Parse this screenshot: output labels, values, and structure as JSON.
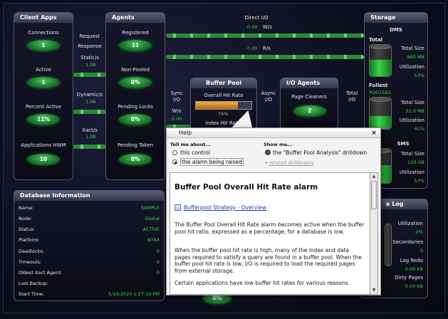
{
  "client_apps": {
    "title": "Client Apps",
    "items": [
      {
        "label": "Connections",
        "value": "1"
      },
      {
        "label": "Active",
        "value": "1"
      },
      {
        "label": "Percent Active",
        "value": "11%"
      },
      {
        "label": "Applications HWM",
        "value": "10"
      }
    ]
  },
  "request_response": {
    "request_label": "Request",
    "response_label": "Response",
    "static_label": "Static/s",
    "static_value": "1.08",
    "dynamic_label": "Dynamic/s",
    "dynamic_value": "1.08",
    "xact_label": "Xact/s",
    "xact_value": "1.08"
  },
  "agents": {
    "title": "Agents",
    "items": [
      {
        "label": "Registered",
        "value": "11"
      },
      {
        "label": "Non-Pooled",
        "value": "0%"
      },
      {
        "label": "Pending Locks",
        "value": "0%"
      },
      {
        "label": "Pending Token",
        "value": "0%"
      }
    ]
  },
  "direct_io": {
    "title": "Direct I/O",
    "write_value": "0.00",
    "write_unit": "W/s",
    "read_value": "0.00",
    "read_unit": "R/s"
  },
  "buffer_pool": {
    "title": "Buffer Pool",
    "hit_rate_label": "Overall Hit Rate",
    "hit_rate_value": "75%",
    "hit_rate_fraction": 0.75,
    "index_label": "Index Hit Ratio"
  },
  "sync_io": {
    "label1": "Sync",
    "label2": "I/O",
    "unit": "W/s",
    "value": "0.00"
  },
  "async_io": {
    "label1": "Async",
    "label2": "I/O"
  },
  "io_agents": {
    "title": "I/O Agents",
    "page_cleaners_label": "Page Cleaners",
    "page_cleaners_value": "2"
  },
  "total_io": {
    "label1": "Total",
    "label2": "I/O"
  },
  "storage": {
    "title": "Storage",
    "dms_label": "DMS",
    "total_label": "Total",
    "total_size_label": "Total Size",
    "total_size_value": "900 MB",
    "utilization_label": "Utilization",
    "total_util_value": "53%",
    "total_util_fraction": 0.53,
    "fullest_label": "Fullest",
    "fullest_name": "POD1SA1",
    "fullest_size_label": "Total Size",
    "fullest_size_value": "32.0 MB",
    "fullest_util_label": "Utilization",
    "fullest_util_value": "41%",
    "fullest_util_fraction": 0.41,
    "sms_label": "SMS",
    "sms_size_label": "Total Size",
    "sms_size_value": "120 GB",
    "sms_util_label": "Utilization",
    "sms_util_value": "53%",
    "sms_util_fraction": 0.53
  },
  "log": {
    "title_suffix": "e Log",
    "utilization_label": "Utilization",
    "utilization_value": "0%",
    "secondaries_label": "Secondaries",
    "secondaries_value": "0",
    "log_redo_label": "Log Redo",
    "log_redo_value": "0.00 KB",
    "dirty_pages_label": "Dirty Pages",
    "dirty_pages_value": "0.00 KB"
  },
  "partial_bottom_value": "0%",
  "database_info": {
    "title": "Database Information",
    "rows": [
      {
        "key": "Name:",
        "value": "SAMPLE"
      },
      {
        "key": "Node:",
        "value": "Global"
      },
      {
        "key": "Status:",
        "value": "ACTIVE"
      },
      {
        "key": "Platform:",
        "value": "NT64"
      },
      {
        "key": "Deadlocks:",
        "value": "0"
      },
      {
        "key": "Timeouts:",
        "value": "0"
      },
      {
        "key": "Oldest Xact Agent:",
        "value": "0"
      },
      {
        "key": "Last Backup:",
        "value": ""
      },
      {
        "key": "Start Time:",
        "value": "5/10/2020 1:27:19 PM"
      }
    ]
  },
  "help": {
    "title": "Help",
    "close_glyph": "×",
    "tell_me_label": "Tell me about...",
    "option_control": "this control",
    "option_alarm": "the alarm being raised",
    "show_me_label": "Show me...",
    "show_me_item": "the \"Buffer Pool Analysis\" drilldown",
    "related_label": "related drilldowns",
    "content_title": "Buffer Pool Overall Hit Rate alarm",
    "link_text": "Bufferpool Strategy - Overview",
    "para1": "The Buffer Pool Overall Hit Rate alarm becomes active when the buffer pool hit ratio, expressed as a percentage, for a database is low.",
    "para2": "When the buffer pool hit rate is high, many of the index and data pages required to satisfy a query are found in a buffer pool. When the buffer pool hit rate is low, I/O is required to load the required pages from external storage.",
    "para3": "Certain applications have low buffer hit rates for various reasons."
  },
  "colors": {
    "accent_green": "#3fd24a",
    "bar_orange": "#e08a2a",
    "link_blue": "#1a3fb0"
  }
}
